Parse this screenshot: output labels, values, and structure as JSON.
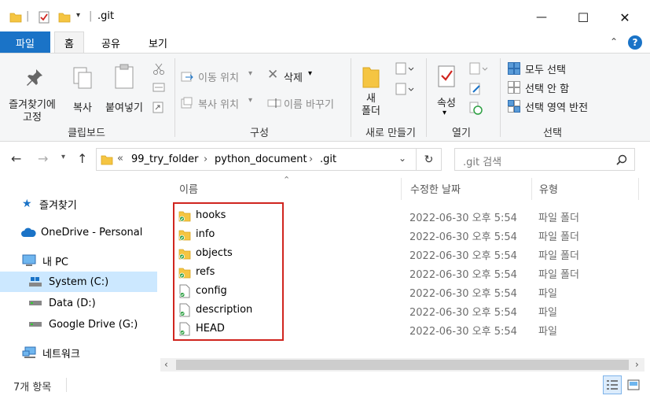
{
  "title": {
    "window_title": ".git",
    "quick_access_separator": "|",
    "minimize": "—",
    "maximize": "☐",
    "close": "✕"
  },
  "tabs": {
    "file": "파일",
    "home": "홈",
    "share": "공유",
    "view": "보기"
  },
  "ribbon": {
    "pin_label": "즐겨찾기에\n고정",
    "copy_label": "복사",
    "paste_label": "붙여넣기",
    "clipboard_group": "클립보드",
    "move_to": "이동 위치",
    "copy_to": "복사 위치",
    "delete": "삭제",
    "rename": "이름 바꾸기",
    "organize_group": "구성",
    "new_folder": "새\n폴더",
    "new_group": "새로 만들기",
    "properties": "속성",
    "open_group": "열기",
    "select_all": "모두 선택",
    "select_none": "선택 안 함",
    "invert_selection": "선택 영역 반전",
    "select_group": "선택"
  },
  "address": {
    "overflow": "«",
    "crumbs": [
      "99_try_folder",
      "python_document",
      ".git"
    ],
    "search_placeholder": ".git 검색"
  },
  "nav": {
    "quick_access": "즐겨찾기",
    "onedrive": "OneDrive - Personal",
    "this_pc": "내 PC",
    "system_c": "System (C:)",
    "data_d": "Data (D:)",
    "google_drive": "Google Drive (G:)",
    "network": "네트워크"
  },
  "columns": {
    "name": "이름",
    "modified": "수정한 날짜",
    "type": "유형"
  },
  "files": [
    {
      "name": "hooks",
      "modified": "2022-06-30 오후 5:54",
      "type": "파일 폴더",
      "kind": "folder"
    },
    {
      "name": "info",
      "modified": "2022-06-30 오후 5:54",
      "type": "파일 폴더",
      "kind": "folder"
    },
    {
      "name": "objects",
      "modified": "2022-06-30 오후 5:54",
      "type": "파일 폴더",
      "kind": "folder"
    },
    {
      "name": "refs",
      "modified": "2022-06-30 오후 5:54",
      "type": "파일 폴더",
      "kind": "folder"
    },
    {
      "name": "config",
      "modified": "2022-06-30 오후 5:54",
      "type": "파일",
      "kind": "file"
    },
    {
      "name": "description",
      "modified": "2022-06-30 오후 5:54",
      "type": "파일",
      "kind": "file"
    },
    {
      "name": "HEAD",
      "modified": "2022-06-30 오후 5:54",
      "type": "파일",
      "kind": "file"
    }
  ],
  "status": {
    "item_count": "7개 항목"
  },
  "colors": {
    "accent": "#1a73c7",
    "selection": "#cce8ff",
    "highlight_box": "#d0251f",
    "folder": "#f5c542",
    "sync_badge": "#2ea043"
  }
}
